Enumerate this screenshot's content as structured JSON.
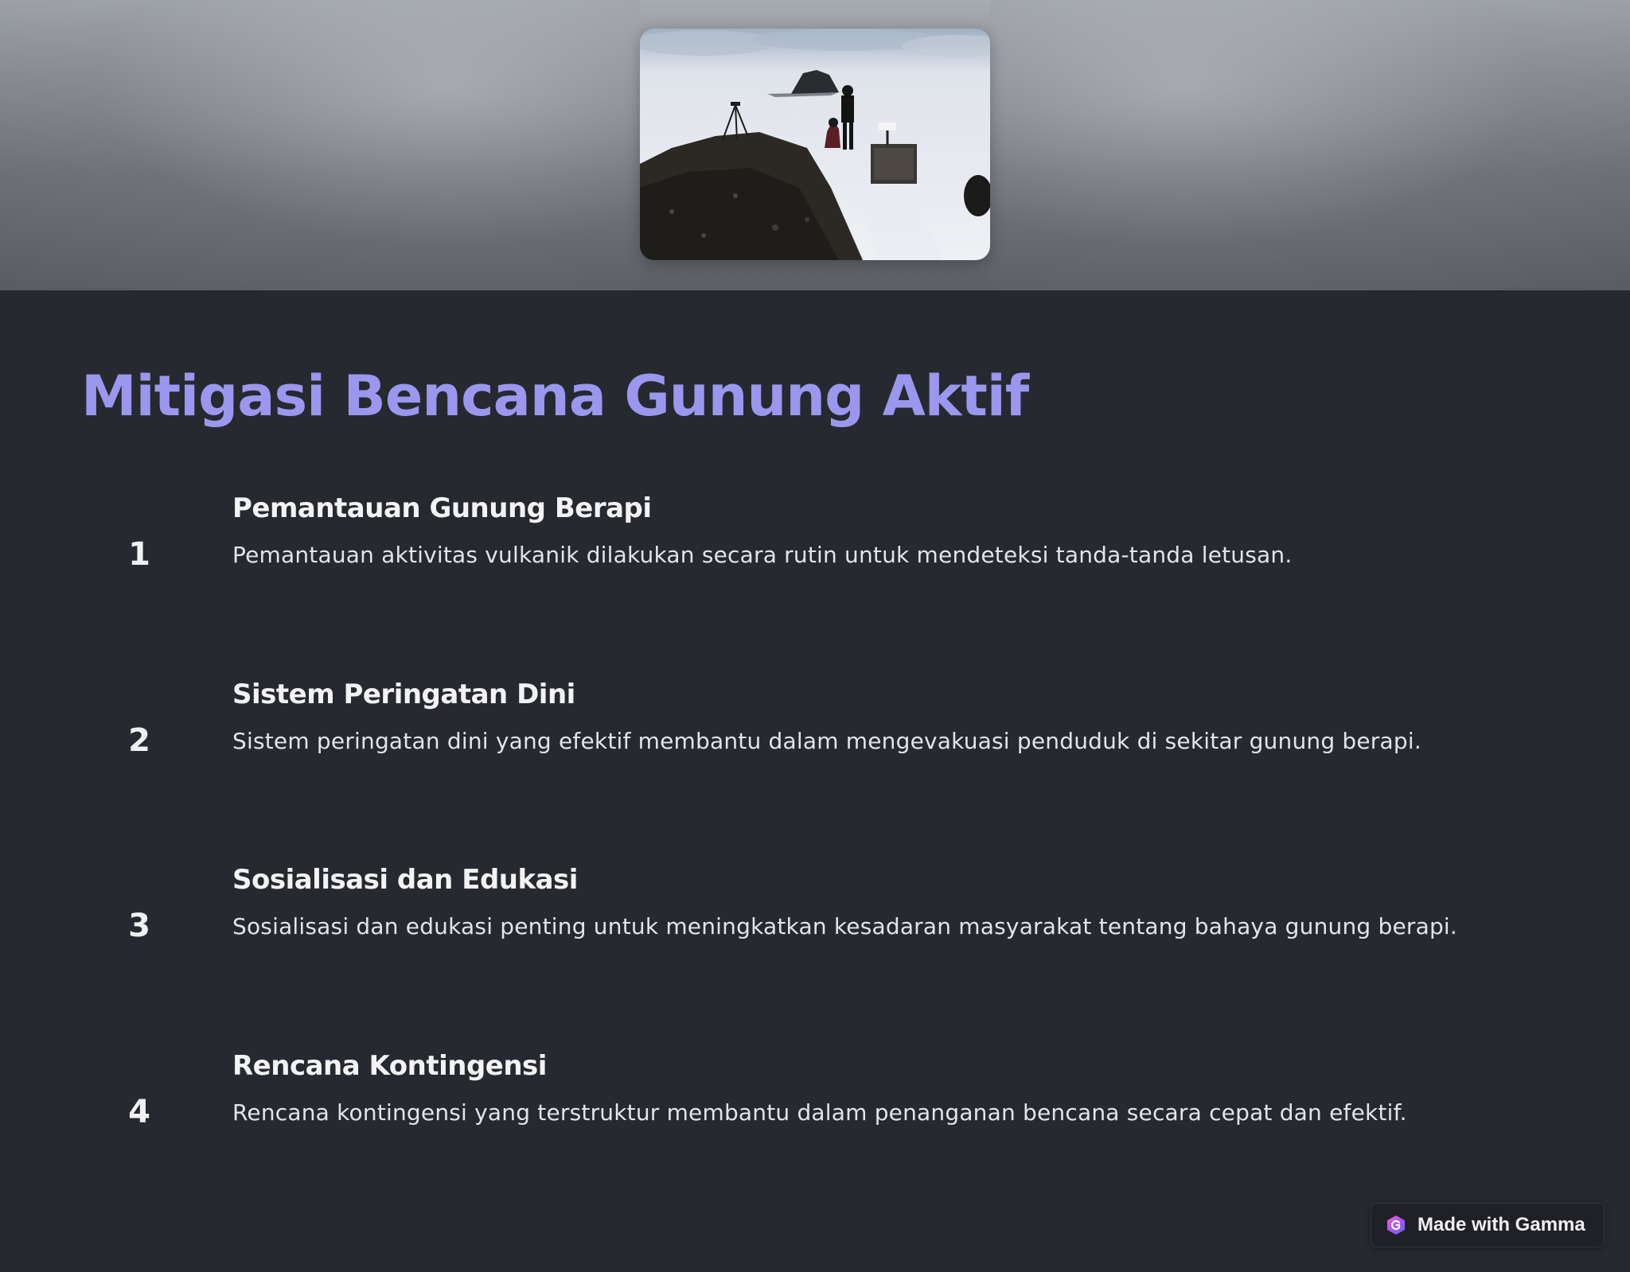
{
  "hero": {
    "image_alt": "Peneliti memantau gunung berapi di puncak bersalju"
  },
  "title": "Mitigasi Bencana Gunung Aktif",
  "steps": [
    {
      "number": "1",
      "title": "Pemantauan Gunung Berapi",
      "description": "Pemantauan aktivitas vulkanik dilakukan secara rutin untuk mendeteksi tanda-tanda letusan."
    },
    {
      "number": "2",
      "title": "Sistem Peringatan Dini",
      "description": "Sistem peringatan dini yang efektif membantu dalam mengevakuasi penduduk di sekitar gunung berapi."
    },
    {
      "number": "3",
      "title": "Sosialisasi dan Edukasi",
      "description": "Sosialisasi dan edukasi penting untuk meningkatkan kesadaran masyarakat tentang bahaya gunung berapi."
    },
    {
      "number": "4",
      "title": "Rencana Kontingensi",
      "description": "Rencana kontingensi yang terstruktur membantu dalam penanganan bencana secara cepat dan efektif."
    }
  ],
  "badge": {
    "label": "Made with Gamma",
    "icon": "gamma-logo-icon"
  },
  "colors": {
    "background": "#26292f",
    "title": "#9b97ee",
    "text": "#f3f3f5",
    "badge_bg": "#1f2126",
    "gamma_purple": "#8b5cf6"
  }
}
